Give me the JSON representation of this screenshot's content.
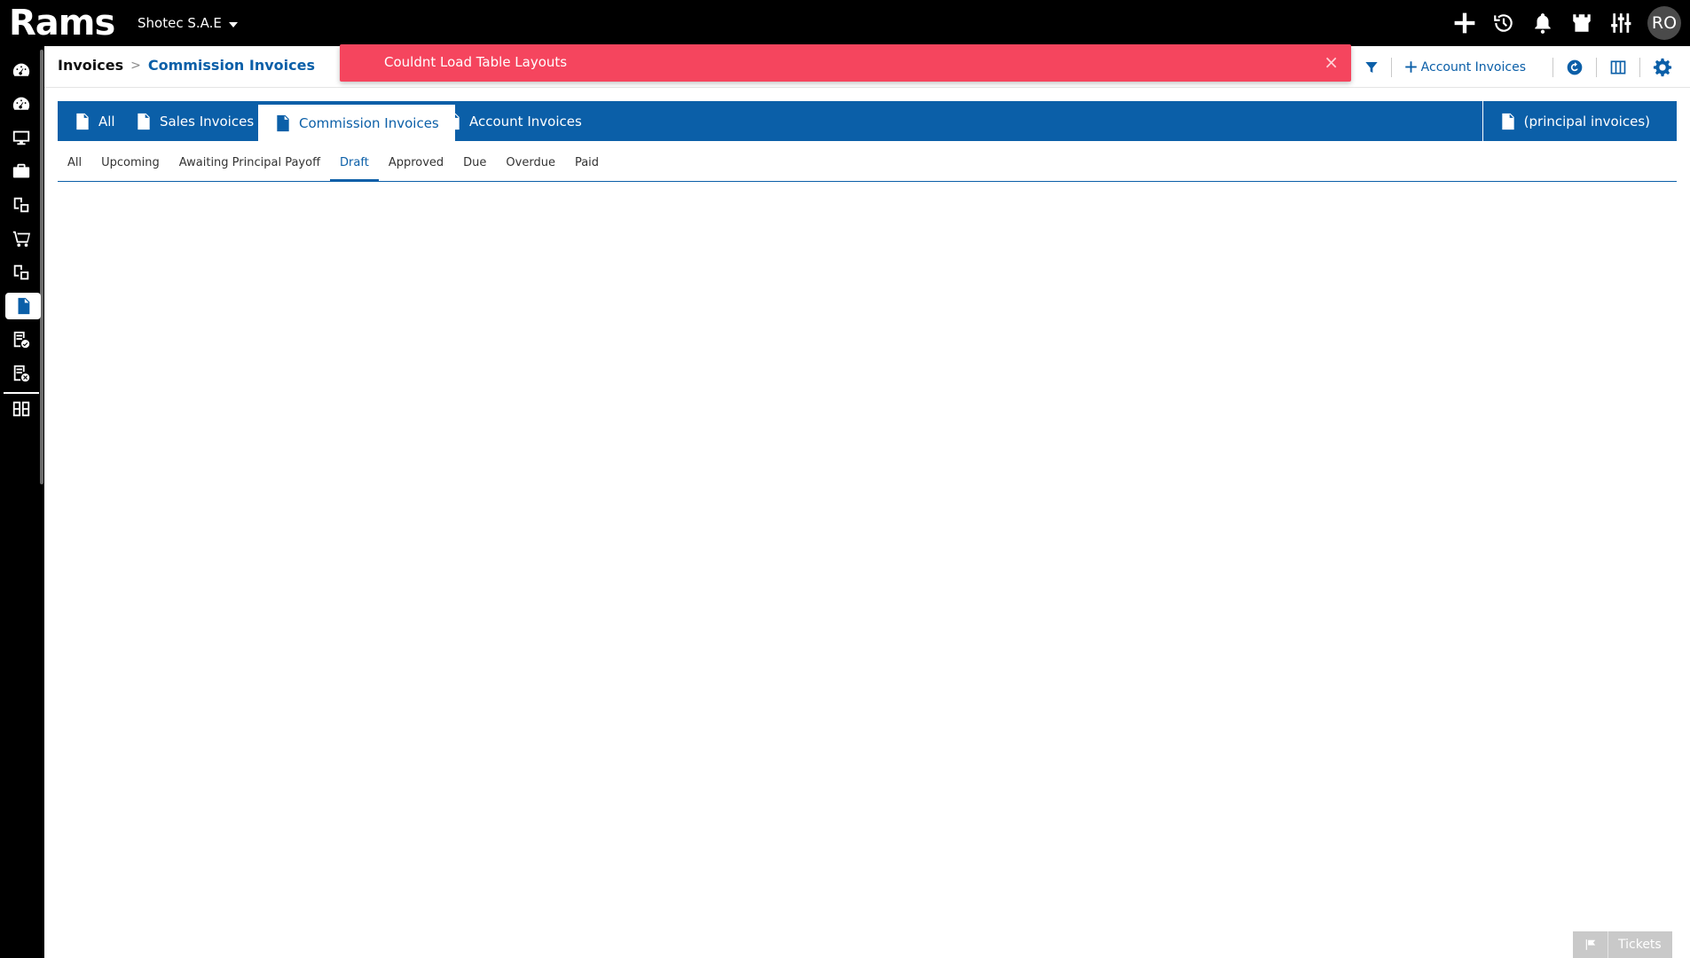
{
  "app": {
    "logo_text": "Rams",
    "company": "Shotec S.A.E",
    "user_initials": "RO"
  },
  "breadcrumb": {
    "root": "Invoices",
    "current": "Commission Invoices"
  },
  "header_tools": {
    "add_label": "Account Invoices"
  },
  "toast": {
    "message": "Couldnt Load Table Layouts",
    "close": "×",
    "color": "#f5455e"
  },
  "tabs": [
    {
      "label": "All",
      "icon": "invoice-icon"
    },
    {
      "label": "Sales Invoices",
      "icon": "invoice-icon"
    },
    {
      "label": "Commission Invoices",
      "icon": "invoice-icon",
      "active": true
    },
    {
      "label": "Account Invoices",
      "icon": "invoice-icon"
    }
  ],
  "tab_right": {
    "label": "(principal invoices)",
    "icon": "invoice-icon"
  },
  "subtabs": [
    {
      "label": "All"
    },
    {
      "label": "Upcoming"
    },
    {
      "label": "Awaiting Principal Payoff"
    },
    {
      "label": "Draft",
      "active": true
    },
    {
      "label": "Approved"
    },
    {
      "label": "Due"
    },
    {
      "label": "Overdue"
    },
    {
      "label": "Paid"
    }
  ],
  "tickets": {
    "label": "Tickets"
  },
  "colors": {
    "accent": "#0b5fa8",
    "topbar": "#000000"
  }
}
